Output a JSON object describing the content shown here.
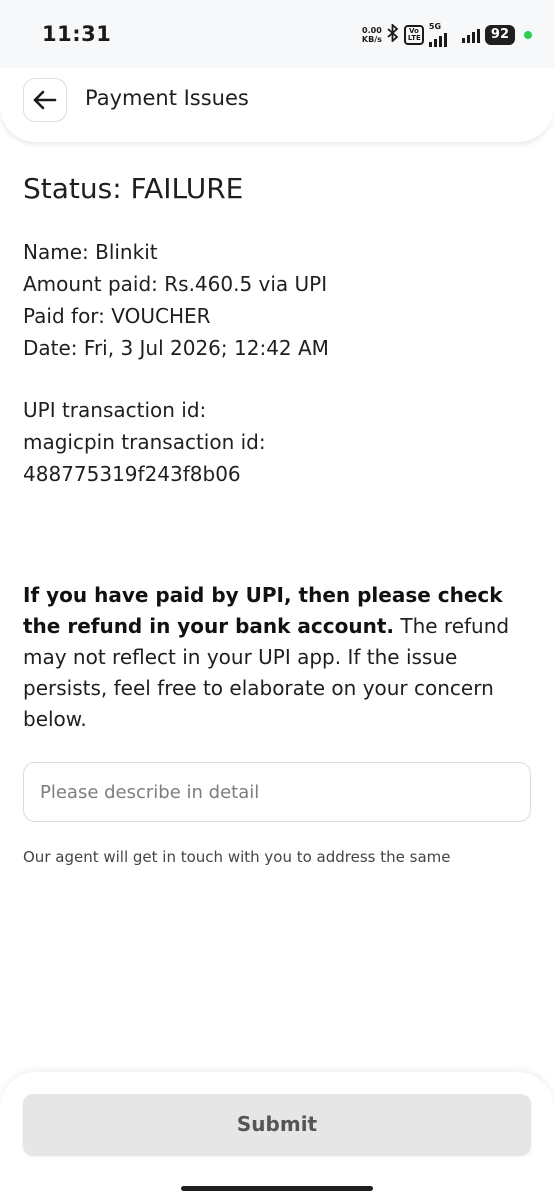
{
  "status_bar": {
    "time": "11:31",
    "net_speed_value": "0.00",
    "net_speed_unit": "KB/s",
    "volte_label": "Vo\nLTE",
    "network_type": "5G",
    "battery": "92",
    "bluetooth_icon": "bluetooth-icon",
    "signal_icon": "signal-bars-icon"
  },
  "header": {
    "title": "Payment Issues",
    "back_icon": "arrow-left-icon"
  },
  "status": {
    "title": "Status: FAILURE"
  },
  "details": {
    "name": "Name: Blinkit",
    "amount": "Amount paid: Rs.460.5 via UPI",
    "paid_for": "Paid for: VOUCHER",
    "date": "Date: Fri, 3 Jul 2026; 12:42 AM"
  },
  "transaction": {
    "upi_id_label": "UPI transaction id:",
    "magicpin_id_label": "magicpin transaction id:",
    "magicpin_id_value": "488775319f243f8b06"
  },
  "notice": {
    "bold_text": "If you have paid by UPI, then please check the refund in your bank account.",
    "regular_text": " The refund may not reflect in your UPI app. If the issue persists, feel free to elaborate on your concern below."
  },
  "form": {
    "input_placeholder": "Please describe in detail",
    "input_value": "",
    "agent_note": "Our agent will get in touch with you to address the same"
  },
  "footer": {
    "submit_label": "Submit"
  },
  "colors": {
    "background": "#ffffff",
    "status_bar_bg": "#f7f8fa",
    "text": "#1f1f1f",
    "submit_bg": "#e6e6e6",
    "submit_text": "#555555",
    "status_dot": "#2ecc52"
  }
}
